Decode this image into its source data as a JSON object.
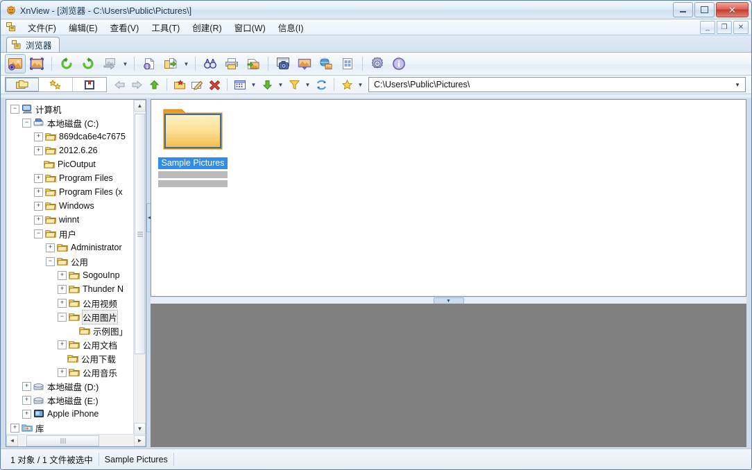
{
  "window": {
    "title": "XnView - [浏览器 - C:\\Users\\Public\\Pictures\\]",
    "app_icon": "xnview-icon",
    "minimize_label": "",
    "maximize_label": "",
    "close_label": "✕"
  },
  "menubar": {
    "icon": "window-list-icon",
    "items": [
      {
        "label": "文件(F)",
        "name": "menu-file"
      },
      {
        "label": "编辑(E)",
        "name": "menu-edit"
      },
      {
        "label": "查看(V)",
        "name": "menu-view"
      },
      {
        "label": "工具(T)",
        "name": "menu-tools"
      },
      {
        "label": "创建(R)",
        "name": "menu-create"
      },
      {
        "label": "窗口(W)",
        "name": "menu-window"
      },
      {
        "label": "信息(I)",
        "name": "menu-info"
      }
    ],
    "mdi_minimize": "_",
    "mdi_restore": "❐",
    "mdi_close": "✕"
  },
  "tabs": [
    {
      "label": "浏览器",
      "icon": "browser-tab-icon",
      "active": true
    }
  ],
  "toolbar": {
    "buttons": [
      {
        "name": "show-browser-icon",
        "tip": "浏览器"
      },
      {
        "name": "show-viewer-icon",
        "tip": "查看器"
      },
      {
        "name": "rotate-left-icon",
        "tip": "左转"
      },
      {
        "name": "rotate-right-icon",
        "tip": "右转"
      },
      {
        "name": "convert-icon",
        "tip": "转换"
      },
      {
        "name": "file-info-icon",
        "tip": "文件信息"
      },
      {
        "name": "export-folder-icon",
        "tip": "导出"
      },
      {
        "name": "search-icon",
        "tip": "查找"
      },
      {
        "name": "print-icon",
        "tip": "打印"
      },
      {
        "name": "batch-convert-icon",
        "tip": "批量转换"
      },
      {
        "name": "screen-capture-icon",
        "tip": "屏幕捕获"
      },
      {
        "name": "slideshow-icon",
        "tip": "幻灯片"
      },
      {
        "name": "web-page-icon",
        "tip": "网页"
      },
      {
        "name": "contact-sheet-icon",
        "tip": "索引图"
      },
      {
        "name": "settings-gear-icon",
        "tip": "设置"
      },
      {
        "name": "about-info-icon",
        "tip": "关于"
      }
    ]
  },
  "toolbar2": {
    "mode_buttons": [
      {
        "name": "folder-tree-mode-icon",
        "selected": true
      },
      {
        "name": "favorites-mode-icon",
        "selected": false
      },
      {
        "name": "catalog-mode-icon",
        "selected": false
      }
    ],
    "nav_buttons": [
      {
        "name": "back-icon"
      },
      {
        "name": "forward-icon"
      },
      {
        "name": "up-icon"
      },
      {
        "name": "new-folder-icon"
      },
      {
        "name": "rename-icon"
      },
      {
        "name": "delete-icon"
      },
      {
        "name": "view-mode-icon"
      },
      {
        "name": "sort-icon"
      },
      {
        "name": "filter-icon"
      },
      {
        "name": "refresh-icon"
      },
      {
        "name": "favorite-star-icon"
      }
    ]
  },
  "address": {
    "value": "C:\\Users\\Public\\Pictures\\",
    "placeholder": "",
    "caret": "▼"
  },
  "tree": {
    "nodes": [
      {
        "label": "计算机",
        "indent": 0,
        "expander": "−",
        "icon": "computer-icon",
        "selected": false
      },
      {
        "label": "本地磁盘 (C:)",
        "indent": 1,
        "expander": "−",
        "icon": "harddisk-icon",
        "selected": false
      },
      {
        "label": "869dca6e4c7675",
        "indent": 2,
        "expander": "+",
        "icon": "folder-icon",
        "selected": false
      },
      {
        "label": "2012.6.26",
        "indent": 2,
        "expander": "+",
        "icon": "folder-icon",
        "selected": false
      },
      {
        "label": "PicOutput",
        "indent": 2,
        "expander": "",
        "icon": "folder-icon",
        "selected": false
      },
      {
        "label": "Program Files",
        "indent": 2,
        "expander": "+",
        "icon": "folder-icon",
        "selected": false
      },
      {
        "label": "Program Files (x",
        "indent": 2,
        "expander": "+",
        "icon": "folder-icon",
        "selected": false
      },
      {
        "label": "Windows",
        "indent": 2,
        "expander": "+",
        "icon": "folder-icon",
        "selected": false
      },
      {
        "label": "winnt",
        "indent": 2,
        "expander": "+",
        "icon": "folder-icon",
        "selected": false
      },
      {
        "label": "用户",
        "indent": 2,
        "expander": "−",
        "icon": "folder-icon",
        "selected": false
      },
      {
        "label": "Administrator",
        "indent": 3,
        "expander": "+",
        "icon": "folder-icon",
        "selected": false
      },
      {
        "label": "公用",
        "indent": 3,
        "expander": "−",
        "icon": "folder-icon",
        "selected": false
      },
      {
        "label": "SogouInp",
        "indent": 4,
        "expander": "+",
        "icon": "folder-icon",
        "selected": false
      },
      {
        "label": "Thunder N",
        "indent": 4,
        "expander": "+",
        "icon": "folder-icon",
        "selected": false
      },
      {
        "label": "公用视频",
        "indent": 4,
        "expander": "+",
        "icon": "folder-icon",
        "selected": false
      },
      {
        "label": "公用图片",
        "indent": 4,
        "expander": "−",
        "icon": "folder-icon",
        "selected": true
      },
      {
        "label": "示例图」",
        "indent": 5,
        "expander": "",
        "icon": "folder-icon",
        "selected": false
      },
      {
        "label": "公用文档",
        "indent": 4,
        "expander": "+",
        "icon": "folder-icon",
        "selected": false
      },
      {
        "label": "公用下载",
        "indent": 4,
        "expander": "",
        "icon": "folder-icon",
        "selected": false
      },
      {
        "label": "公用音乐",
        "indent": 4,
        "expander": "+",
        "icon": "folder-icon",
        "selected": false
      },
      {
        "label": "本地磁盘 (D:)",
        "indent": 1,
        "expander": "+",
        "icon": "cddrive-icon",
        "selected": false
      },
      {
        "label": "本地磁盘 (E:)",
        "indent": 1,
        "expander": "+",
        "icon": "cddrive-icon",
        "selected": false
      },
      {
        "label": "Apple iPhone",
        "indent": 1,
        "expander": "+",
        "icon": "device-icon",
        "selected": false
      },
      {
        "label": "库",
        "indent": 0,
        "expander": "+",
        "icon": "library-icon",
        "selected": false
      }
    ],
    "scroll_up": "▲",
    "scroll_down": "▼",
    "scroll_left": "◄",
    "scroll_right": "►"
  },
  "splitters": {
    "vertical_handle": "◄",
    "horizontal_handle": "▼"
  },
  "browser": {
    "items": [
      {
        "label": "Sample Pictures",
        "icon": "folder-thumbnail-icon",
        "selected": true
      }
    ]
  },
  "statusbar": {
    "cells": [
      "1 对象 / 1 文件被选中",
      "Sample Pictures"
    ]
  },
  "colors": {
    "selection_blue": "#2f8eec",
    "preview_gray": "#808080",
    "folder_yellow": "#ffd877",
    "title_text": "#10314f"
  }
}
